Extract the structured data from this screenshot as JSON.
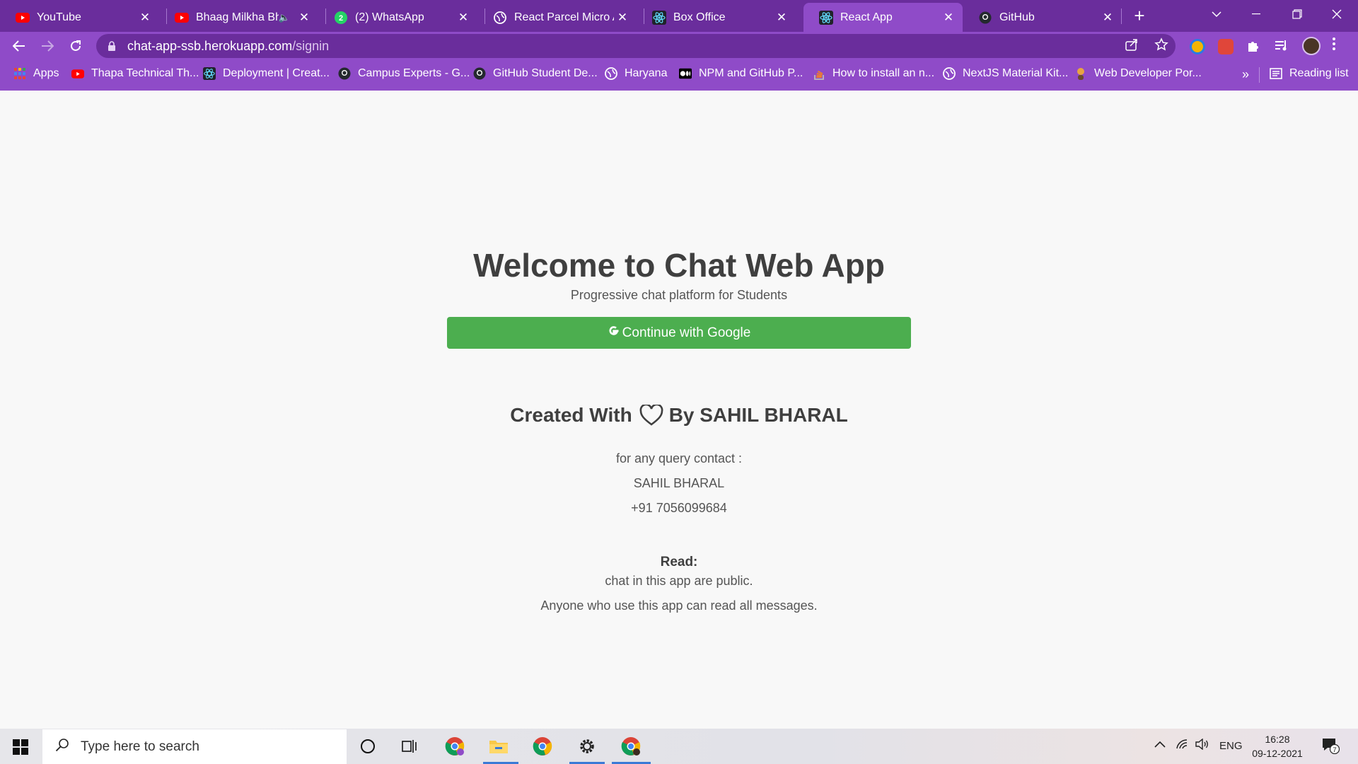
{
  "browser": {
    "tabs": [
      {
        "title": "YouTube",
        "icon": "youtube-icon"
      },
      {
        "title": "Bhaag Milkha Bhaag",
        "icon": "youtube-icon",
        "muted": true
      },
      {
        "title": "(2) WhatsApp",
        "icon": "whatsapp-icon"
      },
      {
        "title": "React Parcel Micro App",
        "icon": "globe-icon"
      },
      {
        "title": "Box Office",
        "icon": "react-icon"
      },
      {
        "title": "React App",
        "icon": "react-icon",
        "active": true
      },
      {
        "title": "GitHub",
        "icon": "github-icon"
      }
    ],
    "url_host": "chat-app-ssb.herokuapp.com",
    "url_path": "/signin",
    "bookmarks": [
      {
        "label": "Apps",
        "icon": "apps-grid-icon"
      },
      {
        "label": "Thapa Technical Th...",
        "icon": "youtube-icon"
      },
      {
        "label": "Deployment | Creat...",
        "icon": "react-icon"
      },
      {
        "label": "Campus Experts - G...",
        "icon": "github-icon"
      },
      {
        "label": "GitHub Student De...",
        "icon": "github-icon"
      },
      {
        "label": "Haryana",
        "icon": "globe-icon"
      },
      {
        "label": "NPM and GitHub P...",
        "icon": "medium-icon"
      },
      {
        "label": "How to install an n...",
        "icon": "stackoverflow-icon"
      },
      {
        "label": "NextJS Material Kit...",
        "icon": "globe-icon"
      },
      {
        "label": "Web Developer Por...",
        "icon": "avatar-icon"
      }
    ],
    "reading_list": "Reading list",
    "more_bookmarks": "»"
  },
  "page": {
    "title": "Welcome to Chat Web App",
    "subtitle": "Progressive chat platform for Students",
    "google_button": "Continue with Google",
    "credit_prefix": "Created With",
    "credit_suffix": "By SAHIL BHARAL",
    "contact_label": "for any query contact :",
    "contact_name": "SAHIL BHARAL",
    "contact_phone": "+91 7056099684",
    "read_heading": "Read:",
    "read_line1": "chat in this app are public.",
    "read_line2": "Anyone who use this app can read all messages."
  },
  "taskbar": {
    "search_placeholder": "Type here to search",
    "language": "ENG",
    "time": "16:28",
    "date": "09-12-2021",
    "notifications": "7"
  },
  "colors": {
    "tab_strip": "#6a2d9c",
    "toolbar": "#8f4bc8",
    "google_button": "#4cae4f"
  }
}
